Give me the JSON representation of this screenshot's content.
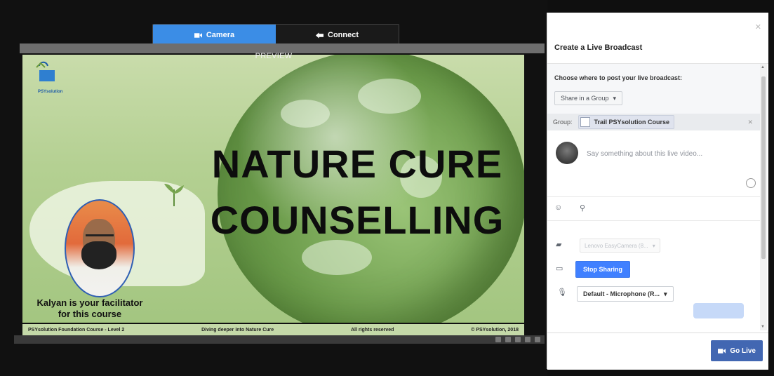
{
  "tabs": [
    {
      "label": "Camera",
      "icon": "video-camera-icon",
      "active": true
    },
    {
      "label": "Connect",
      "icon": "connect-icon",
      "active": false
    }
  ],
  "preview": {
    "label": "PREVIEW",
    "title_line1": "NATURE CURE",
    "title_line2": "COUNSELLING",
    "logo_text": "PSYsolution",
    "facilitator_line1": "Kalyan is your facilitator",
    "facilitator_line2": "for this course",
    "footer": {
      "course": "PSYsolution Foundation Course - Level 2",
      "topic": "Diving deeper into Nature Cure",
      "rights": "All rights reserved",
      "copyright": "© PSYsolution, 2018"
    }
  },
  "panel": {
    "title": "Create a Live Broadcast",
    "close_icon": "close-icon",
    "choose_label": "Choose where to post your live broadcast:",
    "share_option": "Share in a Group",
    "group_label": "Group:",
    "group_name": "Trail PSYsolution Course",
    "say_placeholder": "Say something about this live video...",
    "camera_device": "Lenovo EasyCamera (8...",
    "stop_sharing": "Stop Sharing",
    "microphone_device": "Default - Microphone (R...",
    "go_live": "Go Live"
  },
  "colors": {
    "accent_blue": "#3b8de6",
    "go_live_blue": "#4267b2",
    "stop_sharing_blue": "#4080ff"
  }
}
